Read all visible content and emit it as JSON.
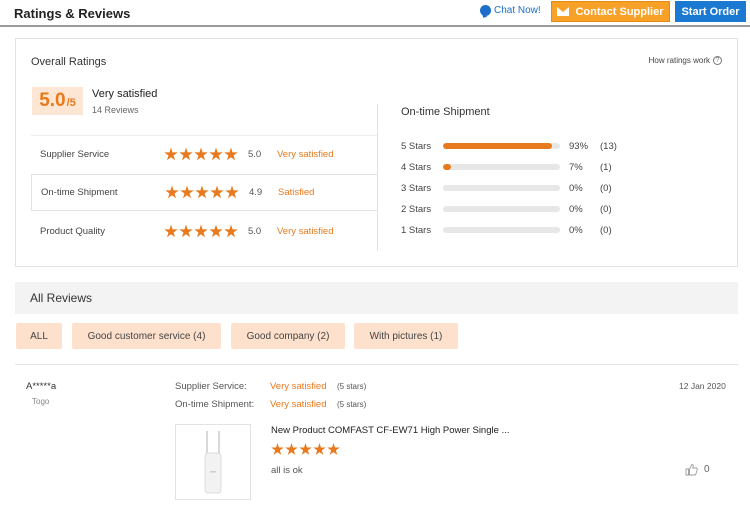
{
  "header": {
    "title": "Ratings & Reviews",
    "chat_label": "Chat Now!",
    "contact_label": "Contact Supplier",
    "order_label": "Start Order"
  },
  "overall": {
    "title": "Overall Ratings",
    "how_label": "How ratings work",
    "score": "5.0",
    "score_max": "/5",
    "score_label": "Very satisfied",
    "review_count": "14 Reviews",
    "categories": [
      {
        "name": "Supplier Service",
        "stars": 5,
        "score": "5.0",
        "label": "Very satisfied"
      },
      {
        "name": "On-time Shipment",
        "stars": 5,
        "score": "4.9",
        "label": "Satisfied"
      },
      {
        "name": "Product Quality",
        "stars": 5,
        "score": "5.0",
        "label": "Very satisfied"
      }
    ]
  },
  "shipment": {
    "title": "On-time Shipment",
    "bars": [
      {
        "label": "5  Stars",
        "percent": 93,
        "pct_text": "93%",
        "count": "(13)"
      },
      {
        "label": "4  Stars",
        "percent": 7,
        "pct_text": "7%",
        "count": "(1)"
      },
      {
        "label": "3  Stars",
        "percent": 0,
        "pct_text": "0%",
        "count": "(0)"
      },
      {
        "label": "2  Stars",
        "percent": 0,
        "pct_text": "0%",
        "count": "(0)"
      },
      {
        "label": "1  Stars",
        "percent": 0,
        "pct_text": "0%",
        "count": "(0)"
      }
    ]
  },
  "reviews": {
    "title": "All Reviews",
    "filters": [
      "ALL",
      "Good customer service (4)",
      "Good company (2)",
      "With pictures (1)"
    ],
    "items": [
      {
        "user": "A*****a",
        "country": "Togo",
        "date": "12 Jan 2020",
        "supplier_service_key": "Supplier Service:",
        "supplier_service_value": "Very satisfied",
        "supplier_service_stars": "(5 stars)",
        "shipment_key": "On-time Shipment:",
        "shipment_value": "Very satisfied",
        "shipment_stars": "(5 stars)",
        "product_title": "New Product COMFAST CF-EW71 High Power Single ...",
        "rating": 5,
        "comment": "all is ok",
        "likes": "0"
      }
    ]
  },
  "colors": {
    "accent": "#e8791c",
    "contact_button": "#f7a128",
    "order_button": "#1c79d2",
    "chat": "#1c6fc8"
  }
}
